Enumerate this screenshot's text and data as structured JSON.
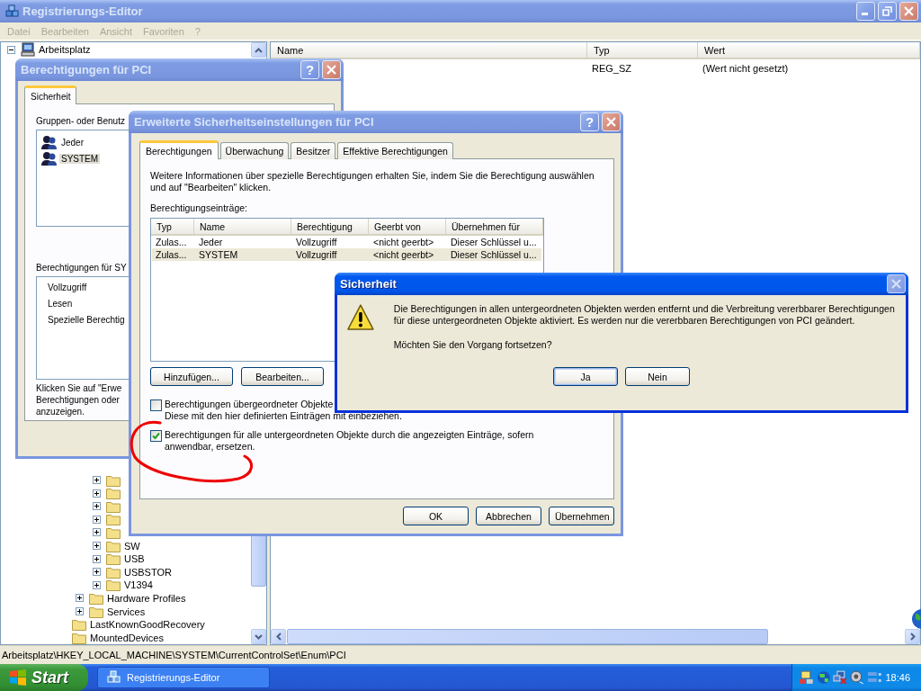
{
  "regedit": {
    "title": "Registrierungs-Editor",
    "active": false,
    "menu": [
      {
        "label": "Datei",
        "disabled": true
      },
      {
        "label": "Bearbeiten",
        "disabled": true
      },
      {
        "label": "Ansicht",
        "disabled": true
      },
      {
        "label": "Favoriten",
        "disabled": true
      },
      {
        "label": "?",
        "disabled": true
      }
    ],
    "tree": [
      {
        "label": "Arbeitsplatz",
        "expanded": true,
        "children": [
          {
            "children": [
              {
                "children": [
                  {
                    "children": [
                      {
                        "children": [
                          {
                            "expanded": false
                          },
                          {
                            "expanded": false
                          },
                          {
                            "expanded": false
                          },
                          {
                            "expanded": false
                          },
                          {
                            "expanded": false
                          },
                          {
                            "label": "SW",
                            "expanded": false
                          },
                          {
                            "label": "USB",
                            "expanded": false
                          },
                          {
                            "label": "USBSTOR",
                            "expanded": false
                          },
                          {
                            "label": "V1394",
                            "expanded": false
                          }
                        ]
                      },
                      {
                        "label": "Hardware Profiles",
                        "expanded": false
                      },
                      {
                        "label": "Services",
                        "expanded": false
                      }
                    ]
                  },
                  {
                    "label": "LastKnownGoodRecovery"
                  },
                  {
                    "label": "MountedDevices"
                  }
                ]
              }
            ]
          }
        ]
      }
    ],
    "list": {
      "columns": [
        "Name",
        "Typ",
        "Wert"
      ],
      "rows": [
        {
          "type": "REG_SZ",
          "value": "(Wert nicht gesetzt)"
        }
      ]
    },
    "status_bar": "Arbeitsplatz\\HKEY_LOCAL_MACHINE\\SYSTEM\\CurrentControlSet\\Enum\\PCI"
  },
  "permissions_dialog": {
    "title": "Berechtigungen für PCI",
    "active": false,
    "help": "?",
    "tabs": [
      {
        "label": "Sicherheit",
        "selected": true
      }
    ],
    "groups_label": "Gruppen- oder Benutz",
    "groups": [
      {
        "name": "Jeder",
        "selected": false
      },
      {
        "name": "SYSTEM",
        "selected": true
      }
    ],
    "permissions_label": "Berechtigungen für SY",
    "permissions": [
      "Vollzugriff",
      "Lesen",
      "Spezielle Berechtig"
    ],
    "note_lines": [
      "Klicken Sie auf \"Erwe",
      "Berechtigungen oder",
      "anzuzeigen."
    ]
  },
  "advanced_dialog": {
    "title": "Erweiterte Sicherheitseinstellungen für PCI",
    "active": false,
    "help": "?",
    "tabs": [
      {
        "label": "Berechtigungen",
        "selected": true
      },
      {
        "label": "Überwachung",
        "selected": false
      },
      {
        "label": "Besitzer",
        "selected": false
      },
      {
        "label": "Effektive Berechtigungen",
        "selected": false
      }
    ],
    "info": "Weitere Informationen über spezielle Berechtigungen erhalten Sie, indem Sie die Berechtigung auswählen und auf \"Bearbeiten\" klicken.",
    "entries_label": "Berechtigungseinträge:",
    "table": {
      "columns": [
        "Typ",
        "Name",
        "Berechtigung",
        "Geerbt von",
        "Übernehmen für"
      ],
      "rows": [
        {
          "cells": [
            "Zulas...",
            "Jeder",
            "Vollzugriff",
            "<nicht geerbt>",
            "Dieser Schlüssel u..."
          ],
          "selected": false
        },
        {
          "cells": [
            "Zulas...",
            "SYSTEM",
            "Vollzugriff",
            "<nicht geerbt>",
            "Dieser Schlüssel u..."
          ],
          "selected": true
        }
      ]
    },
    "buttons": [
      "Hinzufügen...",
      "Bearbeiten..."
    ],
    "checkboxes": [
      {
        "lines": [
          "Berechtigungen übergeordneter Objekte",
          "Diese mit den hier definierten Einträgen mit einbeziehen."
        ],
        "checked": false
      },
      {
        "lines": [
          "Berechtigungen für alle untergeordneten Objekte durch die angezeigten Einträge, sofern",
          "anwendbar, ersetzen."
        ],
        "checked": true
      }
    ],
    "footer_buttons": [
      "OK",
      "Abbrechen",
      "Übernehmen"
    ]
  },
  "message_dialog": {
    "title": "Sicherheit",
    "active": true,
    "close_disabled": true,
    "message": "Die Berechtigungen in allen untergeordneten Objekten werden entfernt und die Verbreitung vererbbarer Berechtigungen für diese untergeordneten Objekte aktiviert. Es werden nur die vererbbaren Berechtigungen von PCI geändert.",
    "question": "Möchten Sie den Vorgang fortsetzen?",
    "buttons": [
      {
        "label": "Ja",
        "default": true
      },
      {
        "label": "Nein",
        "default": false
      }
    ]
  },
  "taskbar": {
    "start": "Start",
    "tasks": [
      {
        "label": "Registrierungs-Editor"
      }
    ],
    "clock": "18:46"
  }
}
